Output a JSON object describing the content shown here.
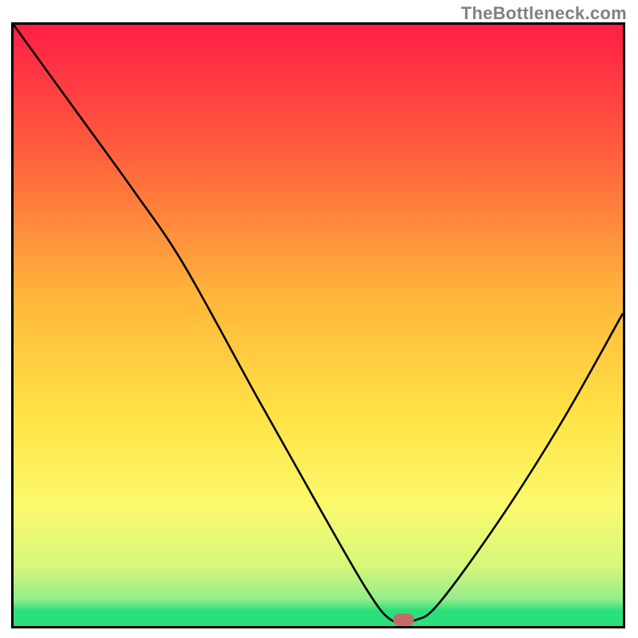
{
  "watermark": "TheBottleneck.com",
  "colors": {
    "frame": "#000000",
    "curve": "#000000",
    "marker": "#c46a66",
    "green_band": "#29e07c"
  },
  "chart_data": {
    "type": "line",
    "title": "",
    "xlabel": "",
    "ylabel": "",
    "xlim": [
      0,
      100
    ],
    "ylim": [
      0,
      100
    ],
    "grid": false,
    "series": [
      {
        "name": "bottleneck-curve",
        "x": [
          0,
          10,
          20,
          28,
          40,
          50,
          58,
          62,
          66,
          70,
          80,
          90,
          100
        ],
        "y": [
          100,
          86,
          72,
          60,
          38,
          20,
          6,
          1,
          1,
          4,
          18,
          34,
          52
        ]
      }
    ],
    "annotations": [
      {
        "name": "optimal-marker",
        "x": 64,
        "y": 1
      }
    ],
    "gradient_stops": [
      {
        "pos": 0.0,
        "color": "#ff1e46"
      },
      {
        "pos": 0.2,
        "color": "#ff5a3d"
      },
      {
        "pos": 0.45,
        "color": "#ffb53b"
      },
      {
        "pos": 0.65,
        "color": "#ffe345"
      },
      {
        "pos": 0.8,
        "color": "#fbf96d"
      },
      {
        "pos": 0.9,
        "color": "#d7f77a"
      },
      {
        "pos": 0.955,
        "color": "#94ed8a"
      },
      {
        "pos": 0.975,
        "color": "#29e07c"
      },
      {
        "pos": 1.0,
        "color": "#29e07c"
      }
    ]
  }
}
